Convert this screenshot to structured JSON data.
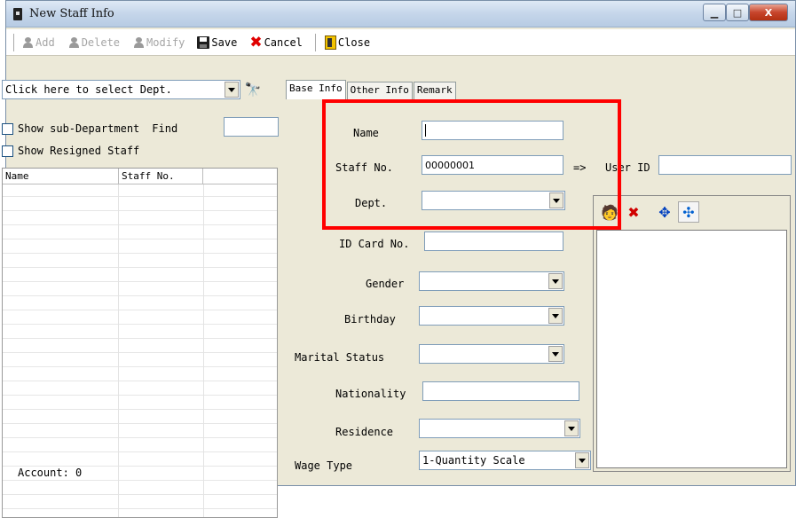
{
  "window": {
    "title": "New Staff Info",
    "controls": {
      "minimize": "▁",
      "maximize": "□",
      "close": "X"
    }
  },
  "toolbar": {
    "add": "Add",
    "delete": "Delete",
    "modify": "Modify",
    "save": "Save",
    "cancel": "Cancel",
    "close": "Close"
  },
  "left_pane": {
    "dept_select": "Click here to select Dept.",
    "show_sub_department": "Show sub-Department",
    "find_label": "Find",
    "show_resigned": "Show Resigned Staff",
    "columns": [
      "Name",
      "Staff No."
    ],
    "account": "Account: 0"
  },
  "tabs": [
    "Base Info",
    "Other Info",
    "Remark"
  ],
  "form": {
    "name_label": "Name",
    "name_value": "",
    "staff_no_label": "Staff No.",
    "staff_no_value": "00000001",
    "arrow": "=>",
    "user_id_label": "User ID",
    "user_id_value": "",
    "dept_label": "Dept.",
    "id_card_label": "ID Card No.",
    "gender_label": "Gender",
    "birthday_label": "Birthday",
    "marital_label": "Marital Status",
    "nationality_label": "Nationality",
    "residence_label": "Residence",
    "wage_type_label": "Wage Type",
    "wage_type_value": "1-Quantity Scale"
  },
  "colors": {
    "highlight": "#ff0000",
    "window_bg": "#ece9d8"
  }
}
